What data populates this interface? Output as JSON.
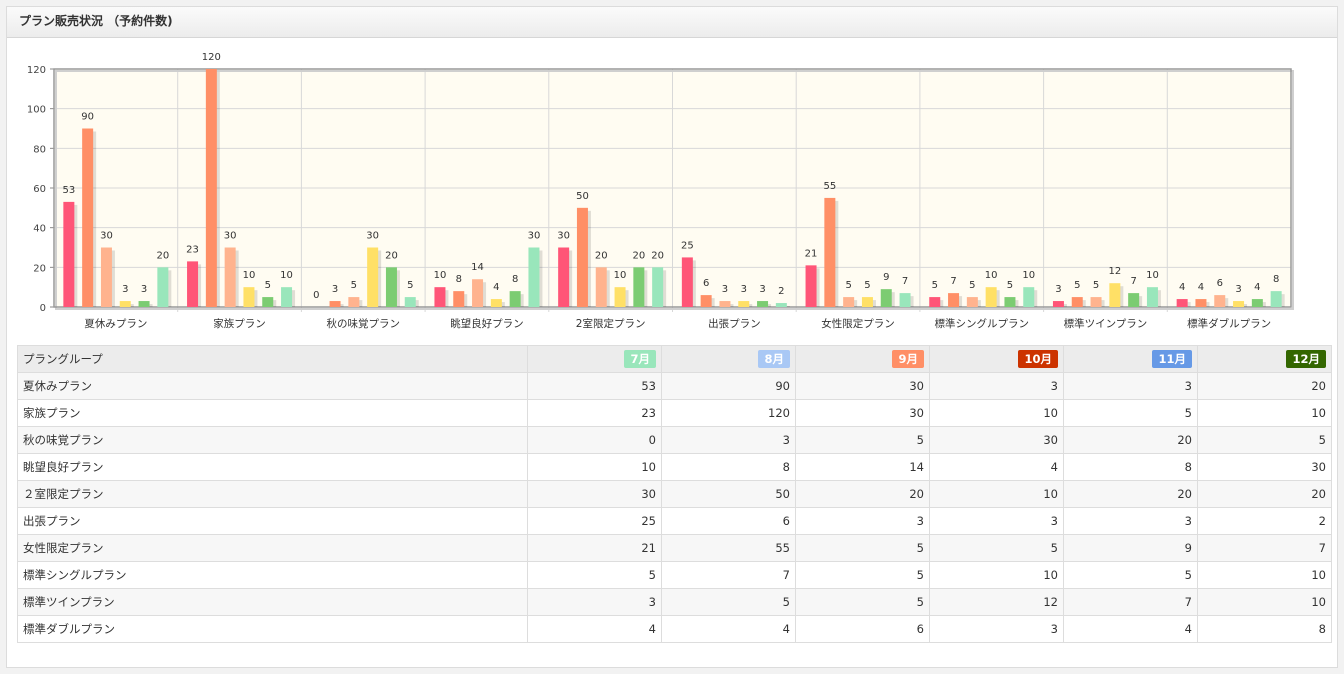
{
  "page": {
    "title": "プラン販売状況 （予約件数)"
  },
  "chart_data": {
    "type": "bar",
    "categories": [
      "夏休みプラン",
      "家族プラン",
      "秋の味覚プラン",
      "眺望良好プラン",
      "2室限定プラン",
      "出張プラン",
      "女性限定プラン",
      "標準シングルプラン",
      "標準ツインプラン",
      "標準ダブルプラン"
    ],
    "series": [
      {
        "name": "7月",
        "color": "#ff5577",
        "values": [
          53,
          23,
          0,
          10,
          30,
          25,
          21,
          5,
          3,
          4
        ]
      },
      {
        "name": "8月",
        "color": "#ff8f66",
        "values": [
          90,
          120,
          3,
          8,
          50,
          6,
          55,
          7,
          5,
          4
        ]
      },
      {
        "name": "9月",
        "color": "#ffb38e",
        "values": [
          30,
          30,
          5,
          14,
          20,
          3,
          5,
          5,
          5,
          6
        ]
      },
      {
        "name": "10月",
        "color": "#ffe066",
        "values": [
          3,
          10,
          30,
          4,
          10,
          3,
          5,
          10,
          12,
          3
        ]
      },
      {
        "name": "11月",
        "color": "#7ccc72",
        "values": [
          3,
          5,
          20,
          8,
          20,
          3,
          9,
          5,
          7,
          4
        ]
      },
      {
        "name": "12月",
        "color": "#99e6bb",
        "values": [
          20,
          10,
          5,
          30,
          20,
          2,
          7,
          10,
          10,
          8
        ]
      }
    ],
    "yticks": [
      "0",
      "20",
      "40",
      "60",
      "80",
      "100",
      "120"
    ],
    "ylim": [
      0,
      120
    ],
    "grid": true,
    "legend": "none"
  },
  "table": {
    "header_label": "プラングループ",
    "months": [
      {
        "label": "7月",
        "color": "#99e6bb"
      },
      {
        "label": "8月",
        "color": "#a9c8f5"
      },
      {
        "label": "9月",
        "color": "#ff8f66"
      },
      {
        "label": "10月",
        "color": "#cc3300"
      },
      {
        "label": "11月",
        "color": "#6699e6"
      },
      {
        "label": "12月",
        "color": "#336600"
      }
    ],
    "rows": [
      {
        "name": "夏休みプラン",
        "values": [
          "53",
          "90",
          "30",
          "3",
          "3",
          "20"
        ]
      },
      {
        "name": "家族プラン",
        "values": [
          "23",
          "120",
          "30",
          "10",
          "5",
          "10"
        ]
      },
      {
        "name": "秋の味覚プラン",
        "values": [
          "0",
          "3",
          "5",
          "30",
          "20",
          "5"
        ]
      },
      {
        "name": "眺望良好プラン",
        "values": [
          "10",
          "8",
          "14",
          "4",
          "8",
          "30"
        ]
      },
      {
        "name": "２室限定プラン",
        "values": [
          "30",
          "50",
          "20",
          "10",
          "20",
          "20"
        ]
      },
      {
        "name": "出張プラン",
        "values": [
          "25",
          "6",
          "3",
          "3",
          "3",
          "2"
        ]
      },
      {
        "name": "女性限定プラン",
        "values": [
          "21",
          "55",
          "5",
          "5",
          "9",
          "7"
        ]
      },
      {
        "name": "標準シングルプラン",
        "values": [
          "5",
          "7",
          "5",
          "10",
          "5",
          "10"
        ]
      },
      {
        "name": "標準ツインプラン",
        "values": [
          "3",
          "5",
          "5",
          "12",
          "7",
          "10"
        ]
      },
      {
        "name": "標準ダブルプラン",
        "values": [
          "4",
          "4",
          "6",
          "3",
          "4",
          "8"
        ]
      }
    ]
  }
}
